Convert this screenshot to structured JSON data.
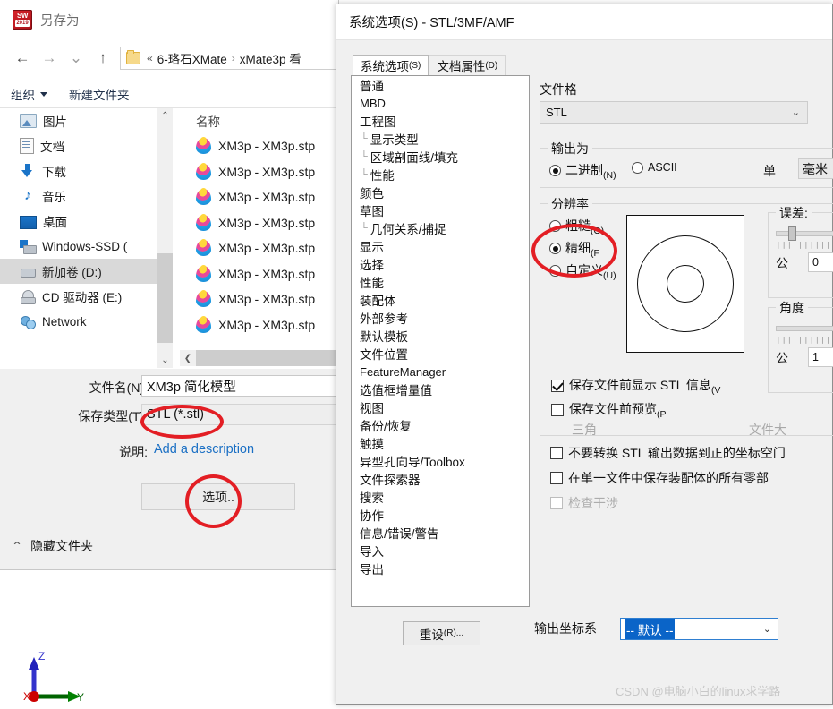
{
  "saveas": {
    "title": "另存为",
    "logo": {
      "name": "SW",
      "year": "2019"
    },
    "nav": {
      "back": "←",
      "forward": "→",
      "recent": "⌄",
      "up": "↑"
    },
    "breadcrumb": {
      "dbl": "«",
      "parts": [
        "6-珞石XMate",
        "xMate3p 看"
      ],
      "sep": "›"
    },
    "toolbar": {
      "organize": "组织",
      "new_folder": "新建文件夹"
    },
    "places": [
      {
        "label": "图片",
        "icon": "pictures-icon",
        "selected": false
      },
      {
        "label": "文档",
        "icon": "documents-icon",
        "selected": false
      },
      {
        "label": "下载",
        "icon": "downloads-icon",
        "selected": false
      },
      {
        "label": "音乐",
        "icon": "music-icon",
        "selected": false
      },
      {
        "label": "桌面",
        "icon": "desktop-icon",
        "selected": false
      },
      {
        "label": "Windows-SSD (",
        "icon": "windows-drive-icon",
        "selected": false
      },
      {
        "label": "新加卷 (D:)",
        "icon": "drive-icon",
        "selected": true
      },
      {
        "label": "CD 驱动器 (E:)",
        "icon": "cd-drive-icon",
        "selected": false
      },
      {
        "label": "Network",
        "icon": "network-icon",
        "selected": false
      }
    ],
    "filelist": {
      "column_header": "名称",
      "rows": [
        "XM3p - XM3p.stp",
        "XM3p - XM3p.stp",
        "XM3p - XM3p.stp",
        "XM3p - XM3p.stp",
        "XM3p - XM3p.stp",
        "XM3p - XM3p.stp",
        "XM3p - XM3p.stp",
        "XM3p - XM3p.stp"
      ]
    },
    "form": {
      "filename_label": "文件名(N):",
      "filename_value": "XM3p 简化模型",
      "savetype_label": "保存类型(T):",
      "savetype_value": "STL (*.stl)",
      "desc_label": "说明:",
      "desc_link": "Add a description",
      "options_button": "选项..",
      "hide_folders": "隐藏文件夹"
    }
  },
  "sysopt": {
    "title": "系统选项(S) - STL/3MF/AMF",
    "tabs": [
      {
        "label": "系统选项",
        "accel": "(S)",
        "active": true
      },
      {
        "label": "文档属性",
        "accel": "(D)",
        "active": false
      }
    ],
    "tree": [
      {
        "label": "普通",
        "child": false,
        "latin": false
      },
      {
        "label": "MBD",
        "child": false,
        "latin": true
      },
      {
        "label": "工程图",
        "child": false,
        "latin": false
      },
      {
        "label": "显示类型",
        "child": true,
        "latin": false
      },
      {
        "label": "区域剖面线/填充",
        "child": true,
        "latin": false
      },
      {
        "label": "性能",
        "child": true,
        "latin": false
      },
      {
        "label": "颜色",
        "child": false,
        "latin": false
      },
      {
        "label": "草图",
        "child": false,
        "latin": false
      },
      {
        "label": "几何关系/捕捉",
        "child": true,
        "latin": false
      },
      {
        "label": "显示",
        "child": false,
        "latin": false
      },
      {
        "label": "选择",
        "child": false,
        "latin": false
      },
      {
        "label": "性能",
        "child": false,
        "latin": false
      },
      {
        "label": "装配体",
        "child": false,
        "latin": false
      },
      {
        "label": "外部参考",
        "child": false,
        "latin": false
      },
      {
        "label": "默认模板",
        "child": false,
        "latin": false
      },
      {
        "label": "文件位置",
        "child": false,
        "latin": false
      },
      {
        "label": "FeatureManager",
        "child": false,
        "latin": true
      },
      {
        "label": "选值框增量值",
        "child": false,
        "latin": false
      },
      {
        "label": "视图",
        "child": false,
        "latin": false
      },
      {
        "label": "备份/恢复",
        "child": false,
        "latin": false
      },
      {
        "label": "触摸",
        "child": false,
        "latin": false
      },
      {
        "label": "异型孔向导/Toolbox",
        "child": false,
        "latin": false
      },
      {
        "label": "文件探索器",
        "child": false,
        "latin": false
      },
      {
        "label": "搜索",
        "child": false,
        "latin": false
      },
      {
        "label": "协作",
        "child": false,
        "latin": false
      },
      {
        "label": "信息/错误/警告",
        "child": false,
        "latin": false
      },
      {
        "label": "导入",
        "child": false,
        "latin": false
      },
      {
        "label": "导出",
        "child": false,
        "latin": false
      }
    ],
    "file_format": {
      "label": "文件格",
      "value": "STL"
    },
    "output_group": {
      "title": "输出为",
      "binary": "二进制",
      "binary_accel": "(N)",
      "ascii": "ASCII",
      "unit_label": "单",
      "unit_value": "毫米",
      "selected": "binary"
    },
    "resolution_group": {
      "title": "分辨率",
      "coarse": "粗糙",
      "coarse_accel": "(O)",
      "fine": "精细",
      "fine_accel": "(F",
      "custom": "自定义",
      "custom_accel": "(U)",
      "selected": "fine",
      "show_info": "保存文件前显示 STL 信息",
      "show_info_accel": "(V",
      "show_info_checked": true,
      "preview": "保存文件前预览",
      "preview_accel": "(P",
      "preview_checked": false,
      "triangles_label": "三角",
      "filesize_label": "文件大"
    },
    "deviation_group": {
      "title": "误差:",
      "unit_label": "公",
      "value": "0"
    },
    "angle_group": {
      "title": "角度",
      "unit_label": "公",
      "value": "1"
    },
    "checkboxes": [
      {
        "label": "不要转换 STL 输出数据到正的坐标空门",
        "checked": false,
        "disabled": false
      },
      {
        "label": "在单一文件中保存装配体的所有零部",
        "checked": false,
        "disabled": false
      },
      {
        "label": "检查干涉",
        "checked": false,
        "disabled": true
      }
    ],
    "reset_button": "重设",
    "reset_accel": "(R)...",
    "output_cs_label": "输出坐标系",
    "output_cs_value": "-- 默认 --"
  },
  "watermark": "CSDN @电脑小白的linux求学路",
  "triad": {
    "x": "X",
    "y": "Y",
    "z": "Z"
  },
  "colors": {
    "accent_red": "#e31e24",
    "link_blue": "#1a6fc4",
    "selection_blue": "#0a64c8",
    "dialog_gray": "#f0f0f0"
  }
}
